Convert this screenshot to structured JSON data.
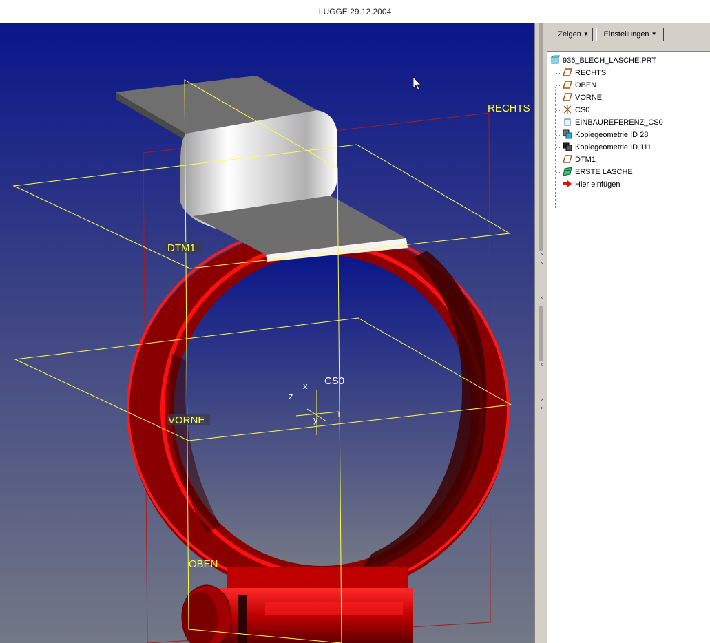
{
  "window": {
    "title": "LUGGE 29.12.2004"
  },
  "toolbar": {
    "show_label": "Zeigen",
    "settings_label": "Einstellungen"
  },
  "model_tree": {
    "root": {
      "label": "936_BLECH_LASCHE.PRT",
      "icon": "part-icon"
    },
    "items": [
      {
        "label": "RECHTS",
        "icon": "datum-plane-icon"
      },
      {
        "label": "OBEN",
        "icon": "datum-plane-icon"
      },
      {
        "label": "VORNE",
        "icon": "datum-plane-icon"
      },
      {
        "label": "CS0",
        "icon": "coordinate-system-icon"
      },
      {
        "label": "EINBAUREFERENZ_CS0",
        "icon": "mounting-reference-icon"
      },
      {
        "label": "Kopiegeometrie ID 28",
        "icon": "copy-geometry-icon"
      },
      {
        "label": "Kopiegeometrie ID 111",
        "icon": "copy-geometry-icon"
      },
      {
        "label": "DTM1",
        "icon": "datum-plane-icon"
      },
      {
        "label": "ERSTE LASCHE",
        "icon": "sheetmetal-wall-icon"
      },
      {
        "label": "Hier einfügen",
        "icon": "insert-here-arrow-icon"
      }
    ]
  },
  "viewport": {
    "datum_labels": {
      "rechts": "RECHTS",
      "dtm1": "DTM1",
      "vorne": "VORNE",
      "oben": "OBEN",
      "cs0": "CS0"
    },
    "axis_labels": {
      "x": "x",
      "y": "y",
      "z": "z"
    },
    "colors": {
      "background_top": "#0c1a8e",
      "background_bottom": "#6f7585",
      "datum_plane": "#ffff44",
      "part": "#d40000",
      "sheet_metal": "#8a8a8a"
    }
  }
}
